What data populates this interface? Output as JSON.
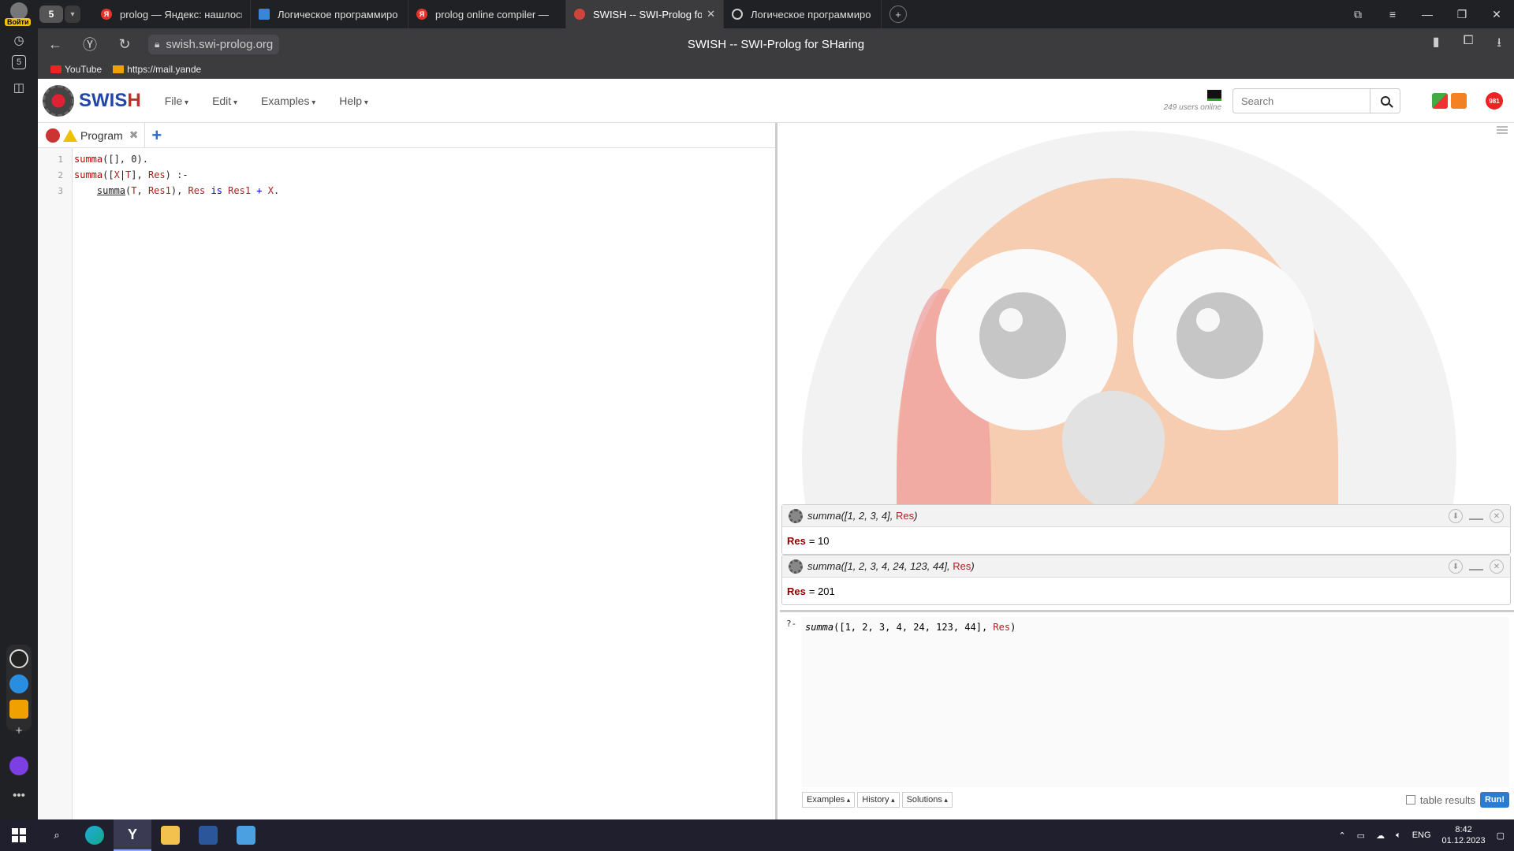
{
  "browser": {
    "profile_login": "Войти",
    "tab_count": "5",
    "tabs": [
      {
        "label": "prolog — Яндекс: нашлось"
      },
      {
        "label": "Логическое программиро"
      },
      {
        "label": "prolog online compiler — "
      },
      {
        "label": "SWISH -- SWI-Prolog for SHaring"
      },
      {
        "label": "Логическое программиро"
      }
    ],
    "url": "swish.swi-prolog.org",
    "page_title": "SWISH -- SWI-Prolog for SHaring",
    "bookmarks": [
      {
        "label": "YouTube"
      },
      {
        "label": "https://mail.yande"
      }
    ],
    "left_badge": "5"
  },
  "swish": {
    "logo_text_a": "SWIS",
    "logo_text_b": "H",
    "menu": [
      "File",
      "Edit",
      "Examples",
      "Help"
    ],
    "users_online": "249 users online",
    "search_placeholder": "Search",
    "notif_count": "981",
    "program_tab": "Program"
  },
  "code_lines": [
    "1",
    "2",
    "3"
  ],
  "queries": [
    {
      "goal_fn": "summa",
      "goal_args": "([1, 2, 3, 4], ",
      "goal_var": "Res",
      "goal_end": ")",
      "result_var": "Res",
      "result_value": "= 10"
    },
    {
      "goal_fn": "summa",
      "goal_args": "([1, 2, 3, 4, 24, 123, 44], ",
      "goal_var": "Res",
      "goal_end": ")",
      "result_var": "Res",
      "result_value": "= 201"
    }
  ],
  "query_editor": {
    "prompt": "?-",
    "fn": "summa",
    "args": "([1, 2, 3, 4, 24, 123, 44], ",
    "var": "Res",
    "end": ")"
  },
  "query_buttons": [
    "Examples",
    "History",
    "Solutions"
  ],
  "table_results_label": "table results",
  "run_label": "Run!",
  "taskbar": {
    "lang": "ENG",
    "time": "8:42",
    "date": "01.12.2023"
  }
}
